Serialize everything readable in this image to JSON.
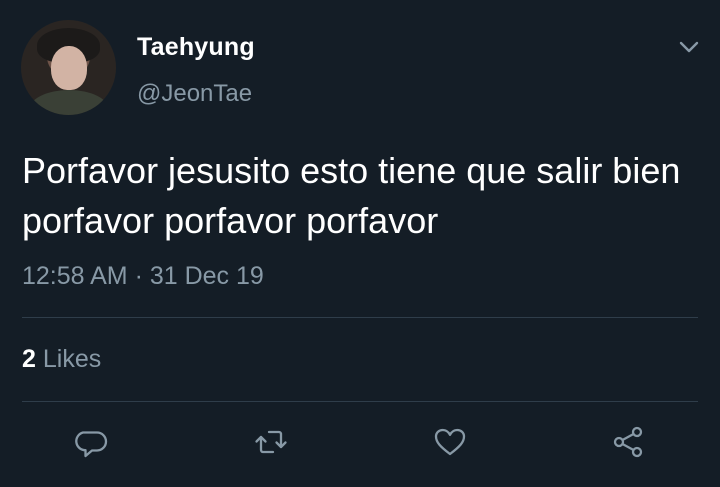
{
  "tweet": {
    "display_name": "Taehyung",
    "handle": "@JeonTae",
    "text": "Porfavor jesusito esto tiene que salir bien porfavor porfavor porfavor",
    "timestamp": "12:58 AM · 31 Dec 19",
    "likes_count": "2",
    "likes_label": "Likes"
  },
  "icons": {
    "menu": "chevron-down-icon",
    "reply": "reply-icon",
    "retweet": "retweet-icon",
    "like": "heart-icon",
    "share": "share-icon"
  },
  "colors": {
    "background": "#141d26",
    "primary_text": "#ffffff",
    "secondary_text": "#8899a6",
    "divider": "#2f3d4a"
  }
}
